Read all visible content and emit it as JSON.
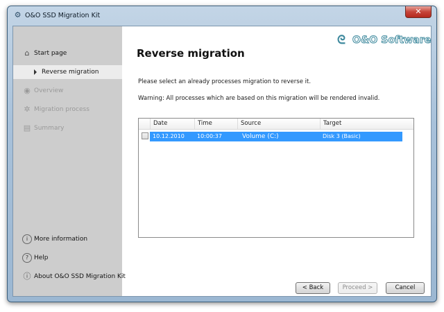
{
  "window": {
    "title": "O&O SSD Migration Kit",
    "close_symbol": "✕",
    "app_icon": "gear-icon"
  },
  "brand": {
    "logo_text": "O&O Software",
    "logo_color": "#3f8a9e"
  },
  "sidebar": {
    "items": [
      {
        "label": "Start page",
        "icon": "home-icon",
        "state": "normal"
      },
      {
        "label": "Reverse migration",
        "icon": "arrow-right-icon",
        "state": "active"
      },
      {
        "label": "Overview",
        "icon": "eye-icon",
        "state": "disabled"
      },
      {
        "label": "Migration process",
        "icon": "gear-icon",
        "state": "disabled"
      },
      {
        "label": "Summary",
        "icon": "document-icon",
        "state": "disabled"
      }
    ],
    "bottom_items": [
      {
        "label": "More information",
        "icon": "info-icon"
      },
      {
        "label": "Help",
        "icon": "question-icon"
      },
      {
        "label": "About O&O SSD Migration Kit",
        "icon": "about-icon"
      }
    ]
  },
  "main": {
    "title": "Reverse migration",
    "instruction": "Please select an already processes migration to reverse it.",
    "warning": "Warning: All processes which are based on this migration will be rendered invalid.",
    "table": {
      "columns": [
        "Date",
        "Time",
        "Source",
        "Target"
      ],
      "rows": [
        {
          "checked": false,
          "selected": true,
          "date": "10.12.2010",
          "time": "10:00:37",
          "source": "Volume (C:)",
          "target": "Disk 3 (Basic)"
        }
      ]
    }
  },
  "buttons": {
    "back": "< Back",
    "proceed": "Proceed >",
    "cancel": "Cancel"
  },
  "colors": {
    "selection": "#3399ff",
    "sidebar_bg": "#cdcdcd",
    "active_item_bg": "#ececec"
  }
}
